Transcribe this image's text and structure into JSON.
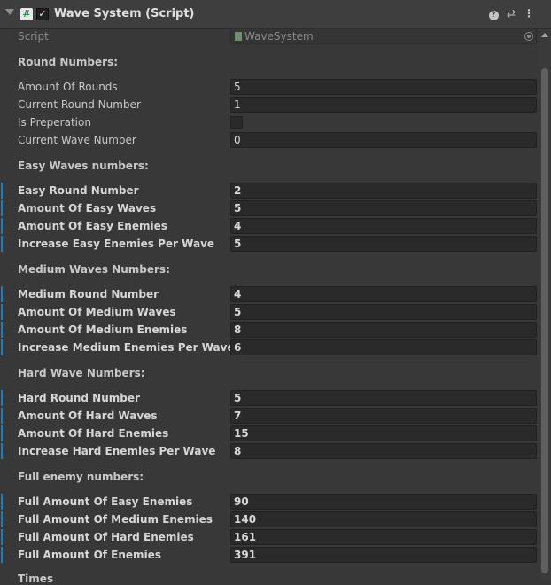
{
  "component": {
    "title": "Wave System (Script)",
    "enabled": true
  },
  "script": {
    "label": "Script",
    "value": "WaveSystem"
  },
  "headings": {
    "round": "Round Numbers:",
    "easy": "Easy Waves numbers:",
    "medium": "Medium Waves Numbers:",
    "hard": "Hard Wave Numbers:",
    "full": "Full enemy numbers:",
    "times": "Times"
  },
  "round": [
    {
      "label": "Amount Of Rounds",
      "value": "5"
    },
    {
      "label": "Current Round Number",
      "value": "1"
    },
    {
      "label": "Is Preperation",
      "checked": false
    },
    {
      "label": "Current Wave Number",
      "value": "0"
    }
  ],
  "easy": [
    {
      "label": "Easy Round Number",
      "value": "2"
    },
    {
      "label": "Amount Of Easy Waves",
      "value": "5"
    },
    {
      "label": "Amount Of Easy Enemies",
      "value": "4"
    },
    {
      "label": "Increase Easy Enemies Per Wave",
      "value": "5"
    }
  ],
  "medium": [
    {
      "label": "Medium Round Number",
      "value": "4"
    },
    {
      "label": "Amount Of Medium Waves",
      "value": "5"
    },
    {
      "label": "Amount Of Medium Enemies",
      "value": "8"
    },
    {
      "label": "Increase Medium Enemies Per Wave",
      "value": "6"
    }
  ],
  "hard": [
    {
      "label": "Hard Round Number",
      "value": "5"
    },
    {
      "label": "Amount Of Hard Waves",
      "value": "7"
    },
    {
      "label": "Amount Of Hard Enemies",
      "value": "15"
    },
    {
      "label": "Increase Hard Enemies Per Wave",
      "value": "8"
    }
  ],
  "full": [
    {
      "label": "Full Amount Of Easy Enemies",
      "value": "90"
    },
    {
      "label": "Full Amount Of Medium Enemies",
      "value": "140"
    },
    {
      "label": "Full Amount Of Hard Enemies",
      "value": "161"
    },
    {
      "label": "Full Amount Of Enemies",
      "value": "391"
    }
  ],
  "icons": {
    "header": [
      "foldout-arrow-icon",
      "script-icon",
      "checkbox-icon",
      "help-icon",
      "presets-icon",
      "kebab-menu-icon"
    ],
    "script_field": [
      "cs-script-icon",
      "object-picker-icon"
    ]
  },
  "colors": {
    "background": "#383838",
    "field": "#2a2a2a",
    "modified_marker": "#0f81c8",
    "text": "#d2d2d2"
  }
}
